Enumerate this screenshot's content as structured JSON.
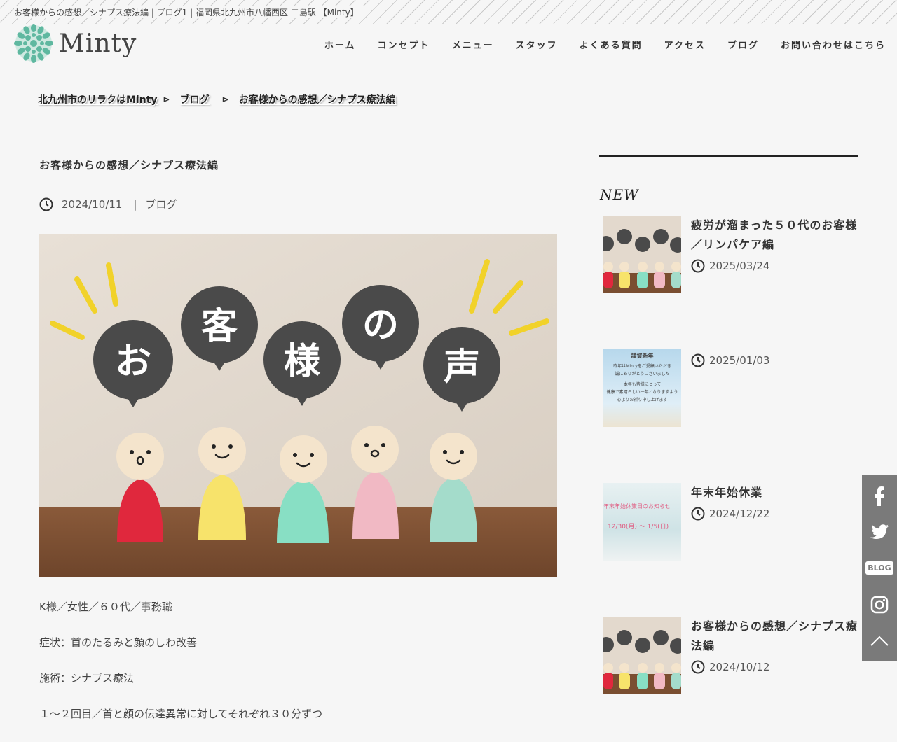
{
  "page_title": "お客様からの感想／シナプス療法編 | ブログ1 | 福岡県北九州市八幡西区 二島駅 【Minty】",
  "logo_text": "Minty",
  "nav": [
    "ホーム",
    "コンセプト",
    "メニュー",
    "スタッフ",
    "よくある質問",
    "アクセス",
    "ブログ",
    "お問い合わせはこちら"
  ],
  "breadcrumb": [
    "北九州市のリラクはMinty",
    "ブログ",
    "お客様からの感想／シナプス療法編"
  ],
  "breadcrumb_sep": "⊳",
  "post": {
    "title": "お客様からの感想／シナプス療法編",
    "date": "2024/10/11",
    "separator": "|",
    "category": "ブログ",
    "hero_labels": [
      "お",
      "客",
      "様",
      "の",
      "声"
    ],
    "body": [
      "K様／女性／６０代／事務職",
      "症状：首のたるみと顔のしわ改善",
      "施術：シナプス療法",
      "１～２回目／首と顔の伝達異常に対してそれぞれ３０分ずつ"
    ]
  },
  "sidebar": {
    "heading": "NEW",
    "items": [
      {
        "title": "疲労が溜まった５０代のお客様／リンパケア編",
        "date": "2025/03/24",
        "thumb": "voice"
      },
      {
        "title": "",
        "date": "2025/01/03",
        "thumb": "newyear",
        "thumb_lines": [
          "謹賀新年",
          "昨年はMintyをご愛顧いただき",
          "誠にありがとうございました",
          "本年も皆様にとって",
          "健康で素晴らしい一年となりますよう",
          "心よりお祈り申し上げます"
        ]
      },
      {
        "title": "年末年始休業",
        "date": "2024/12/22",
        "thumb": "holiday",
        "thumb_lines": [
          "年末年始休業日のお知らせ",
          "12/30(月) ～ 1/5(日)"
        ]
      },
      {
        "title": "お客様からの感想／シナプス療法編",
        "date": "2024/10/12",
        "thumb": "voice"
      }
    ]
  },
  "social": [
    "facebook",
    "twitter",
    "BLOG",
    "instagram",
    "page-top"
  ],
  "colors": {
    "background": "#f6f6f6",
    "text": "#333333",
    "social_bar": "#7a7a7a",
    "logo_green": "#5fb8a0",
    "bubble": "#4a4a4a"
  }
}
